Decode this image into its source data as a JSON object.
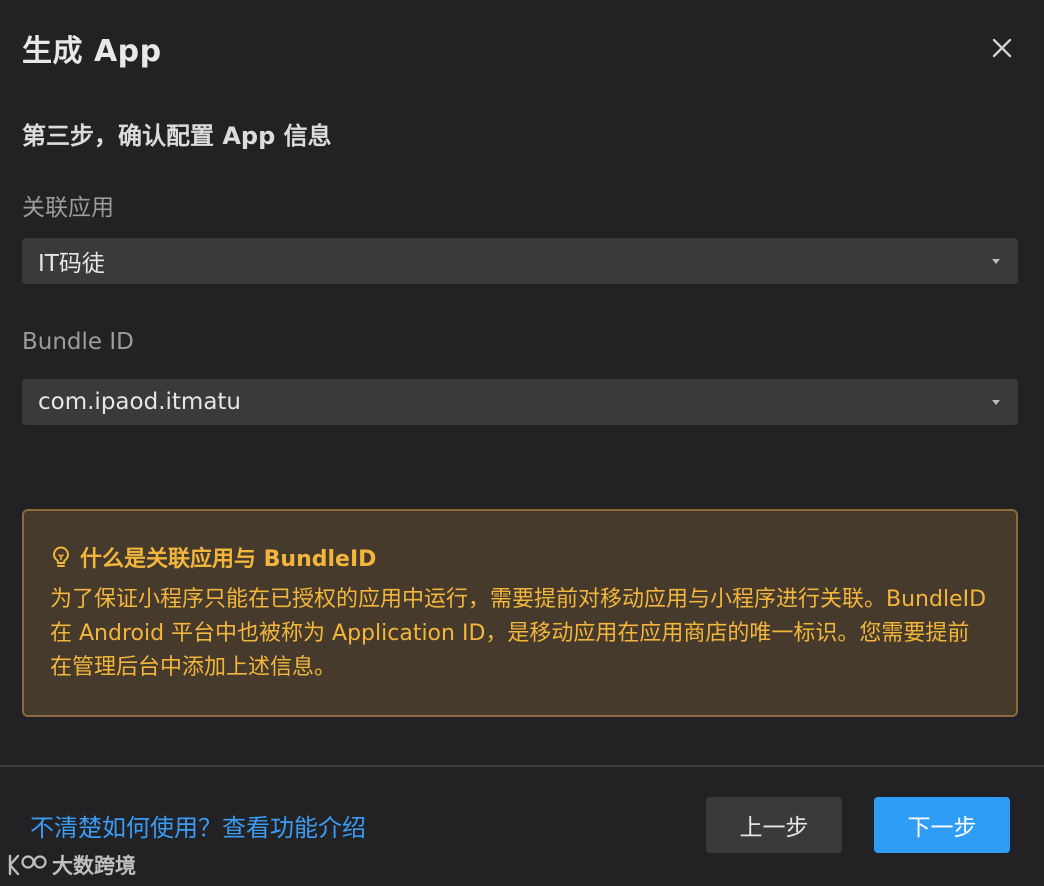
{
  "dialog": {
    "title": "生成 App",
    "close_icon": "close-icon"
  },
  "step": {
    "title": "第三步，确认配置 App 信息"
  },
  "fields": {
    "linked_app": {
      "label": "关联应用",
      "value": "IT码徒"
    },
    "bundle_id": {
      "label": "Bundle ID",
      "value": "com.ipaod.itmatu"
    }
  },
  "notice": {
    "icon": "lightbulb-icon",
    "title": "什么是关联应用与 BundleID",
    "body": "为了保证小程序只能在已授权的应用中运行，需要提前对移动应用与小程序进行关联。BundleID 在 Android 平台中也被称为 Application ID，是移动应用在应用商店的唯一标识。您需要提前在管理后台中添加上述信息。",
    "color": "#f3b63c",
    "background": "#463a2c"
  },
  "footer": {
    "help_link": "不清楚如何使用？查看功能介绍",
    "prev_label": "上一步",
    "next_label": "下一步",
    "accent": "#2f9df5"
  },
  "watermark": {
    "text": "大数跨境"
  }
}
